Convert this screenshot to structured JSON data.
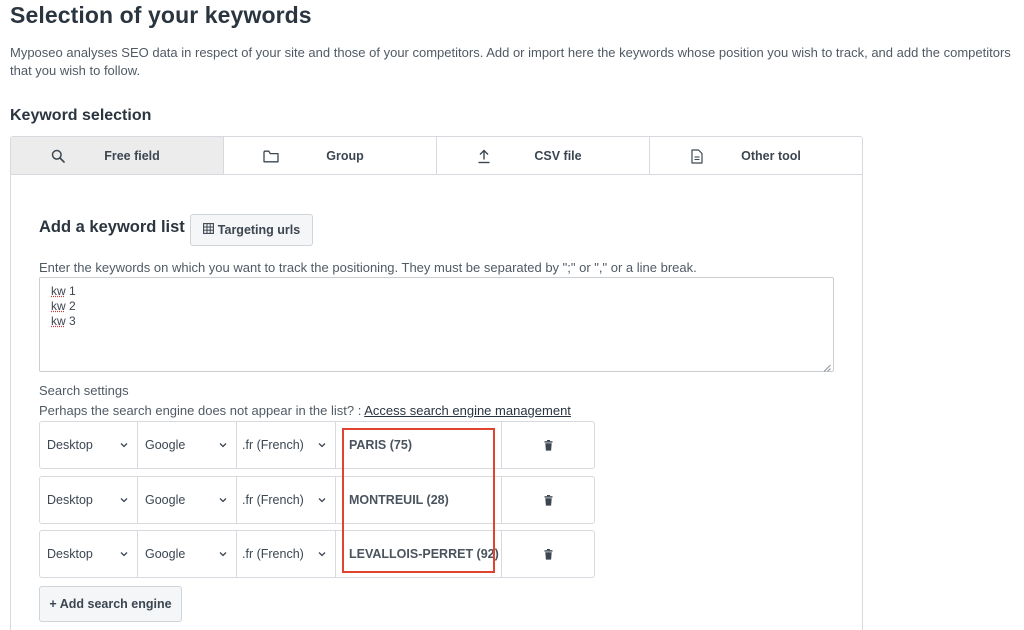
{
  "page": {
    "title": "Selection of your keywords",
    "description": "Myposeo analyses SEO data in respect of your site and those of your competitors. Add or import here the keywords whose position you wish to track, and add the competitors that you wish to follow."
  },
  "keyword_section": {
    "title": "Keyword selection",
    "tabs": [
      {
        "label": "Free field",
        "icon": "search-icon",
        "active": true
      },
      {
        "label": "Group",
        "icon": "folder-icon",
        "active": false
      },
      {
        "label": "CSV file",
        "icon": "upload-icon",
        "active": false
      },
      {
        "label": "Other tool",
        "icon": "document-icon",
        "active": false
      }
    ]
  },
  "keyword_list": {
    "title": "Add a keyword list",
    "targeting_button": "Targeting urls",
    "instructions": "Enter the keywords on which you want to track the positioning. They must be separated by \";\" or \",\" or a line break.",
    "keywords": [
      {
        "word": "kw",
        "num": "1"
      },
      {
        "word": "kw",
        "num": "2"
      },
      {
        "word": "kw",
        "num": "3"
      }
    ]
  },
  "search_settings": {
    "label": "Search settings",
    "hint": "Perhaps the search engine does not appear in the list? : ",
    "hint_link": "Access search engine management",
    "rows": [
      {
        "device": "Desktop",
        "engine": "Google",
        "tld": ".fr (French)",
        "location": "PARIS (75)"
      },
      {
        "device": "Desktop",
        "engine": "Google",
        "tld": ".fr (French)",
        "location": "MONTREUIL (28)"
      },
      {
        "device": "Desktop",
        "engine": "Google",
        "tld": ".fr (French)",
        "location": "LEVALLOIS-PERRET (92)"
      }
    ],
    "add_button": "+ Add search engine"
  },
  "colors": {
    "highlight": "#e0432e",
    "active_tab": "#ececec",
    "border": "#d6dade"
  }
}
